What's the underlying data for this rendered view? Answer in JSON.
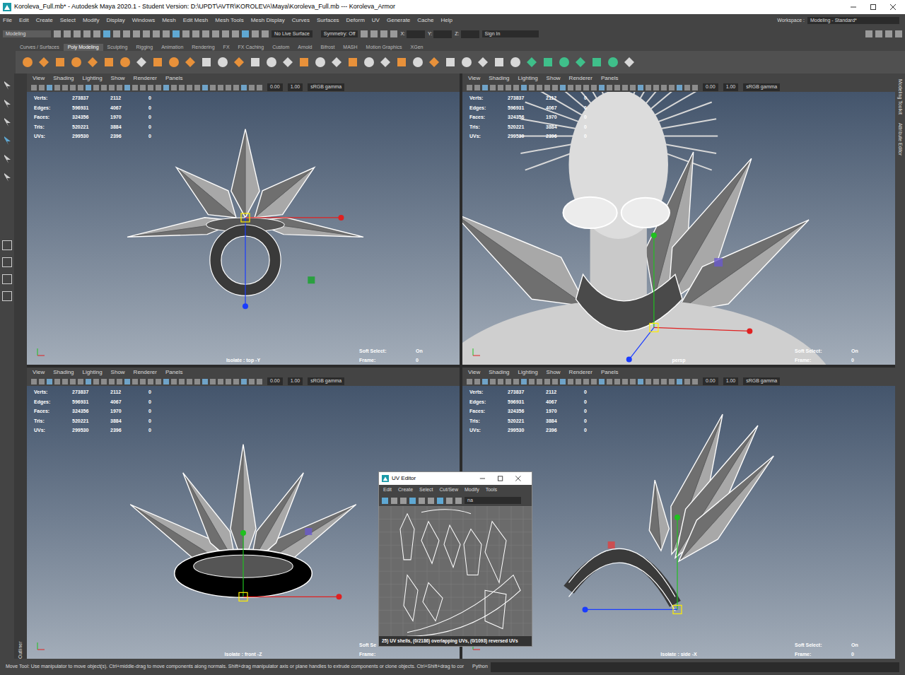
{
  "window": {
    "title": "Koroleva_Full.mb* - Autodesk Maya 2020.1 - Student Version: D:\\UPDT\\AVTR\\KOROLEVA\\Maya\\Koroleva_Full.mb  ---  Koroleva_Armor"
  },
  "menu_bar": [
    "File",
    "Edit",
    "Create",
    "Select",
    "Modify",
    "Display",
    "Windows",
    "Mesh",
    "Edit Mesh",
    "Mesh Tools",
    "Mesh Display",
    "Curves",
    "Surfaces",
    "Deform",
    "UV",
    "Generate",
    "Cache",
    "Help"
  ],
  "workspace": {
    "label": "Workspace :",
    "value": "Modeling - Standard*"
  },
  "status_line": {
    "mode": "Modeling",
    "live_surface": "No Live Surface",
    "symmetry": "Symmetry: Off",
    "coords": [
      "X:",
      "Y:",
      "Z:"
    ],
    "sign_in": "Sign In"
  },
  "shelf_tabs": [
    {
      "label": "Curves / Surfaces",
      "selected": false
    },
    {
      "label": "Poly Modeling",
      "selected": true
    },
    {
      "label": "Sculpting",
      "selected": false
    },
    {
      "label": "Rigging",
      "selected": false
    },
    {
      "label": "Animation",
      "selected": false
    },
    {
      "label": "Rendering",
      "selected": false
    },
    {
      "label": "FX",
      "selected": false
    },
    {
      "label": "FX Caching",
      "selected": false
    },
    {
      "label": "Custom",
      "selected": false
    },
    {
      "label": "Arnold",
      "selected": false
    },
    {
      "label": "Bifrost",
      "selected": false
    },
    {
      "label": "MASH",
      "selected": false
    },
    {
      "label": "Motion Graphics",
      "selected": false
    },
    {
      "label": "XGen",
      "selected": false
    }
  ],
  "side_tabs": {
    "left": "Outliner",
    "right": [
      "Modeling Toolkit",
      "Attribute Editor"
    ]
  },
  "panel_menus": [
    "View",
    "Shading",
    "Lighting",
    "Show",
    "Renderer",
    "Panels"
  ],
  "viewports": [
    {
      "kind": "top",
      "exposure": "0.00",
      "gamma": "1.00",
      "color_space": "sRGB gamma",
      "hud": [
        {
          "label": "Verts:",
          "values": [
            "273837",
            "2112",
            "0"
          ]
        },
        {
          "label": "Edges:",
          "values": [
            "596931",
            "4067",
            "0"
          ]
        },
        {
          "label": "Faces:",
          "values": [
            "324356",
            "1970",
            "0"
          ]
        },
        {
          "label": "Tris:",
          "values": [
            "520221",
            "3884",
            "0"
          ]
        },
        {
          "label": "UVs:",
          "values": [
            "299530",
            "2396",
            "0"
          ]
        }
      ],
      "soft_select": "Soft Select:",
      "soft_select_value": "On",
      "frame": "Frame:",
      "frame_value": "0",
      "camera": "Isolate : top -Y"
    },
    {
      "kind": "persp",
      "exposure": "0.00",
      "gamma": "1.00",
      "color_space": "sRGB gamma",
      "hud": [
        {
          "label": "Verts:",
          "values": [
            "273837",
            "2112",
            "0"
          ]
        },
        {
          "label": "Edges:",
          "values": [
            "596931",
            "4067",
            "0"
          ]
        },
        {
          "label": "Faces:",
          "values": [
            "324356",
            "1970",
            "0"
          ]
        },
        {
          "label": "Tris:",
          "values": [
            "520221",
            "3884",
            "0"
          ]
        },
        {
          "label": "UVs:",
          "values": [
            "299530",
            "2396",
            "0"
          ]
        }
      ],
      "soft_select": "Soft Select:",
      "soft_select_value": "On",
      "frame": "Frame:",
      "frame_value": "0",
      "camera": "persp"
    },
    {
      "kind": "front",
      "exposure": "0.00",
      "gamma": "1.00",
      "color_space": "sRGB gamma",
      "hud": [
        {
          "label": "Verts:",
          "values": [
            "273837",
            "2112",
            "0"
          ]
        },
        {
          "label": "Edges:",
          "values": [
            "596931",
            "4067",
            "0"
          ]
        },
        {
          "label": "Faces:",
          "values": [
            "324356",
            "1970",
            "0"
          ]
        },
        {
          "label": "Tris:",
          "values": [
            "520221",
            "3884",
            "0"
          ]
        },
        {
          "label": "UVs:",
          "values": [
            "299530",
            "2396",
            "0"
          ]
        }
      ],
      "soft_select": "Soft Se",
      "frame": "Frame:",
      "camera": "Isolate : front -Z"
    },
    {
      "kind": "side",
      "exposure": "0.00",
      "gamma": "1.00",
      "color_space": "sRGB gamma",
      "hud": [
        {
          "label": "Verts:",
          "values": [
            "273837",
            "2112",
            "0"
          ]
        },
        {
          "label": "Edges:",
          "values": [
            "596931",
            "4067",
            "0"
          ]
        },
        {
          "label": "Faces:",
          "values": [
            "324356",
            "1970",
            "0"
          ]
        },
        {
          "label": "Tris:",
          "values": [
            "520221",
            "3884",
            "0"
          ]
        },
        {
          "label": "UVs:",
          "values": [
            "299530",
            "2396",
            "0"
          ]
        }
      ],
      "soft_select": "Soft Select:",
      "soft_select_value": "On",
      "frame": "Frame:",
      "frame_value": "0",
      "camera": "Isolate : side -X"
    }
  ],
  "uv_editor": {
    "title": "UV Editor",
    "menus": [
      "Edit",
      "Create",
      "Select",
      "Cut/Sew",
      "Modify",
      "Tools"
    ],
    "texture": "na",
    "status": "25) UV shells, (0/2186) overlapping UVs, (0/1093) reversed UVs"
  },
  "help_line": "Move Tool: Use manipulator to move object(s). Ctrl+middle-drag to move components along normals. Shift+drag manipulator axis or plane handles to extrude components or clone objects. Ctrl+Shift+drag to cor",
  "script": "Python"
}
